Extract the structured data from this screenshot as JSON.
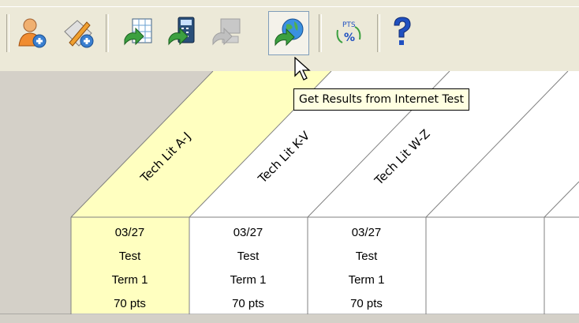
{
  "toolbar": {
    "buttons": [
      {
        "icon": "add-student-icon"
      },
      {
        "icon": "edit-assignment-icon"
      },
      {
        "icon": "import-spreadsheet-icon"
      },
      {
        "icon": "import-calculator-icon"
      },
      {
        "icon": "import-computer-icon",
        "disabled": true
      },
      {
        "icon": "get-internet-results-icon",
        "hovered": true
      },
      {
        "icon": "points-percent-icon",
        "text": "PTS"
      },
      {
        "icon": "help-icon"
      }
    ],
    "pts_text": "PTS",
    "percent_text": "%"
  },
  "tooltip": "Get Results from Internet Test",
  "columns": [
    {
      "label": "Tech Lit A-J",
      "date": "03/27",
      "type": "Test",
      "term": "Term 1",
      "points": "70 pts",
      "highlighted": true
    },
    {
      "label": "Tech Lit K-V",
      "date": "03/27",
      "type": "Test",
      "term": "Term 1",
      "points": "70 pts",
      "highlighted": false
    },
    {
      "label": "Tech Lit W-Z",
      "date": "03/27",
      "type": "Test",
      "term": "Term 1",
      "points": "70 pts",
      "highlighted": false
    }
  ],
  "colors": {
    "highlight": "#ffffc0",
    "grid_line": "#808080",
    "tooltip_bg": "#ffffe1"
  }
}
